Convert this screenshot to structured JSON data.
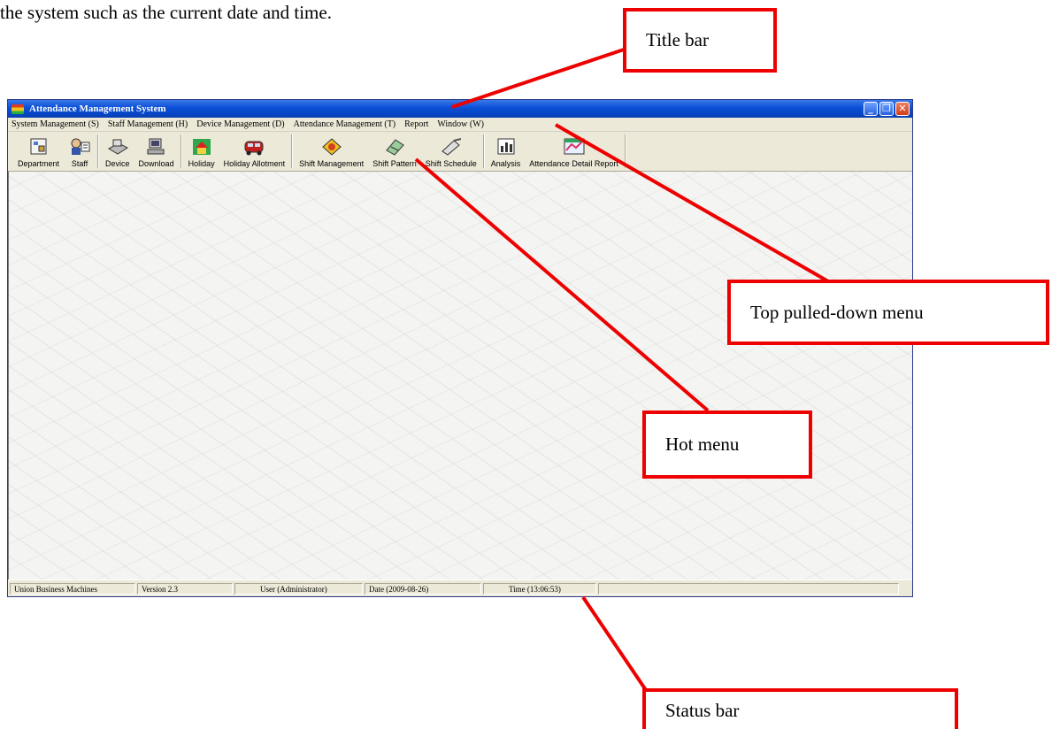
{
  "document": {
    "intro_text": "the system such as the current date and time."
  },
  "window": {
    "title": "Attendance Management System",
    "controls": [
      "minimize-icon",
      "restore-icon",
      "close-icon"
    ]
  },
  "menubar": {
    "items": [
      "System Management (S)",
      "Staff Management (H)",
      "Device Management (D)",
      "Attendance Management (T)",
      "Report",
      "Window (W)"
    ]
  },
  "toolbar": {
    "buttons": [
      {
        "label": "Department",
        "icon": "department-icon"
      },
      {
        "label": "Staff",
        "icon": "staff-icon"
      },
      {
        "label": "Device",
        "icon": "device-icon"
      },
      {
        "label": "Download",
        "icon": "download-icon"
      },
      {
        "label": "Holiday",
        "icon": "holiday-icon"
      },
      {
        "label": "Holiday Allotment",
        "icon": "holiday-allotment-icon"
      },
      {
        "label": "Shift Management",
        "icon": "shift-management-icon"
      },
      {
        "label": "Shift Pattern",
        "icon": "shift-pattern-icon"
      },
      {
        "label": "Shift Schedule",
        "icon": "shift-schedule-icon"
      },
      {
        "label": "Analysis",
        "icon": "analysis-icon"
      },
      {
        "label": "Attendance Detail Report",
        "icon": "attendance-detail-report-icon"
      }
    ]
  },
  "statusbar": {
    "company": "Union Business Machines",
    "version": "Version 2.3",
    "user": "User (Administrator)",
    "date": "Date (2009-08-26)",
    "time": "Time (13:06:53)"
  },
  "callouts": {
    "title_bar": "Title bar",
    "top_menu": "Top pulled-down menu",
    "hot_menu": "Hot menu",
    "status_bar": "Status bar"
  },
  "colors": {
    "callout_border": "#ee0000",
    "titlebar": "#0a4fd6",
    "chrome": "#ece9d8"
  }
}
